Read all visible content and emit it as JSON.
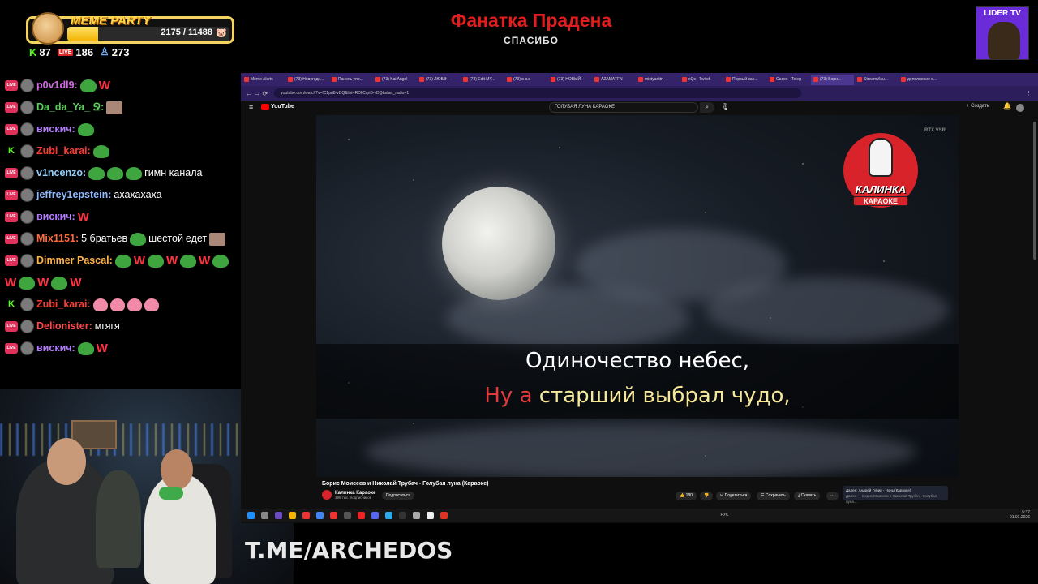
{
  "meme_party": {
    "title": "MEME PARTY",
    "count": "2175 / 11488",
    "fill_fraction": 0.19
  },
  "stats": {
    "kick": "87",
    "youtube": "186",
    "viewers": "273"
  },
  "stream": {
    "title": "Фанатка Прадена",
    "subtitle": "СПАСИБО"
  },
  "lider": "LIDER TV",
  "chat": [
    {
      "platform": "live",
      "user": "p0v1dl9:",
      "color": "#d46ae6",
      "text": "",
      "w": [
        "W"
      ]
    },
    {
      "platform": "live",
      "user": "Da_da_Ya_ Ջ:",
      "color": "#5ad05a",
      "text": "",
      "w": []
    },
    {
      "platform": "live",
      "user": "вискич:",
      "color": "#b37cff",
      "text": "",
      "w": []
    },
    {
      "platform": "kick",
      "user": "Zubi_karai:",
      "color": "#ff3b30",
      "text": "",
      "w": []
    },
    {
      "platform": "live",
      "user": "v1ncenzo:",
      "color": "#8fd0ff",
      "text": "гимн канала",
      "w": []
    },
    {
      "platform": "live",
      "user": "jeffrey1epstein:",
      "color": "#8fb8ff",
      "text": "ахахахаха",
      "w": []
    },
    {
      "platform": "live",
      "user": "вискич:",
      "color": "#b37cff",
      "text": "",
      "w": [
        "W"
      ]
    },
    {
      "platform": "live",
      "user": "Mix1151:",
      "color": "#ff6a3d",
      "text": "5 братьев",
      "text2": "шестой",
      "text3": "едет",
      "w": []
    },
    {
      "platform": "live",
      "user": "Dimmer Pascal:",
      "color": "#ffb347",
      "text": "",
      "w": [
        "W",
        "W",
        "W",
        "W",
        "W",
        "W"
      ]
    },
    {
      "platform": "kick",
      "user": "Zubi_karai:",
      "color": "#ff3b30",
      "text": "",
      "w": []
    },
    {
      "platform": "live",
      "user": "Delionister:",
      "color": "#ff4a4a",
      "text": "мгягя",
      "w": []
    },
    {
      "platform": "live",
      "user": "вискич:",
      "color": "#b37cff",
      "text": "",
      "w": [
        "W"
      ]
    }
  ],
  "watermark": "T.ME/ARCHEDOS",
  "browser": {
    "tabs": [
      "Meme Alerts",
      "(73) Новогодн...",
      "Панель упр...",
      "(73) Kai Angel",
      "(73) ЛЮБЭ -",
      "(73) Edit MY...",
      "(73) в в.в",
      "(73) НОВЫЙ",
      "AZAMATFN",
      "mictyanttn",
      "xQc - Twitch",
      "Первый кан...",
      "Сасоо - Teleg",
      "(73) Бори...",
      "StreamVisu...",
      "дополнение в..."
    ],
    "url": "youtube.com/watch?v=fC1pri8-vDQ&list=RDfiCqriB-vDQ&start_radio=1",
    "search": "ГОЛУБАЯ ЛУНА КАРАОКЕ",
    "youtube": "YouTube",
    "create": "+ Создать"
  },
  "video": {
    "lyric1": "Одиночество небес,",
    "lyric2_sung": "Ну а",
    "lyric2_rest": " старший выбрал чудо,",
    "rtx": "RTX VSR",
    "logo_line1": "КАЛИНКА",
    "logo_line2": "КАРАОКЕ",
    "title": "Борис Моисеев и Николай Трубач - Голубая луна (Караоке)",
    "channel": "Калинка Караоке",
    "subscribers": "399 тыс. подписчиков",
    "subscribe": "Подписаться",
    "likes": "180",
    "share": "Поделиться",
    "save": "Сохранить",
    "download": "Скачать",
    "next_label": "Далее: Андрей Губин - Ночь (Караоке)",
    "next_sub": "Далее — Борис Моисеев и Николай Трубач - Голубая луна..."
  },
  "taskbar": {
    "time": "5:37",
    "date": "01.01.2026",
    "lang": "РУС"
  }
}
